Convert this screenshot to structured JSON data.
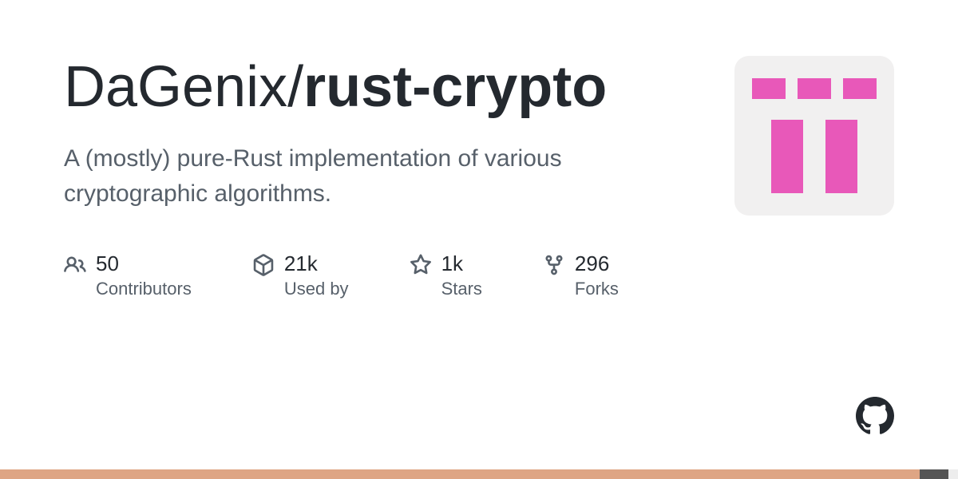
{
  "repo": {
    "owner": "DaGenix",
    "name": "rust-crypto",
    "description": "A (mostly) pure-Rust implementation of various cryptographic algorithms."
  },
  "stats": {
    "contributors": {
      "value": "50",
      "label": "Contributors"
    },
    "used_by": {
      "value": "21k",
      "label": "Used by"
    },
    "stars": {
      "value": "1k",
      "label": "Stars"
    },
    "forks": {
      "value": "296",
      "label": "Forks"
    }
  },
  "avatar": {
    "color": "#e858b9",
    "bg": "#f1f0f0"
  },
  "lang_colors": {
    "rust": "#dea584",
    "c": "#555555",
    "other": "#ededed"
  },
  "lang_split": {
    "rust": 0.96,
    "c": 0.03,
    "other": 0.01
  }
}
